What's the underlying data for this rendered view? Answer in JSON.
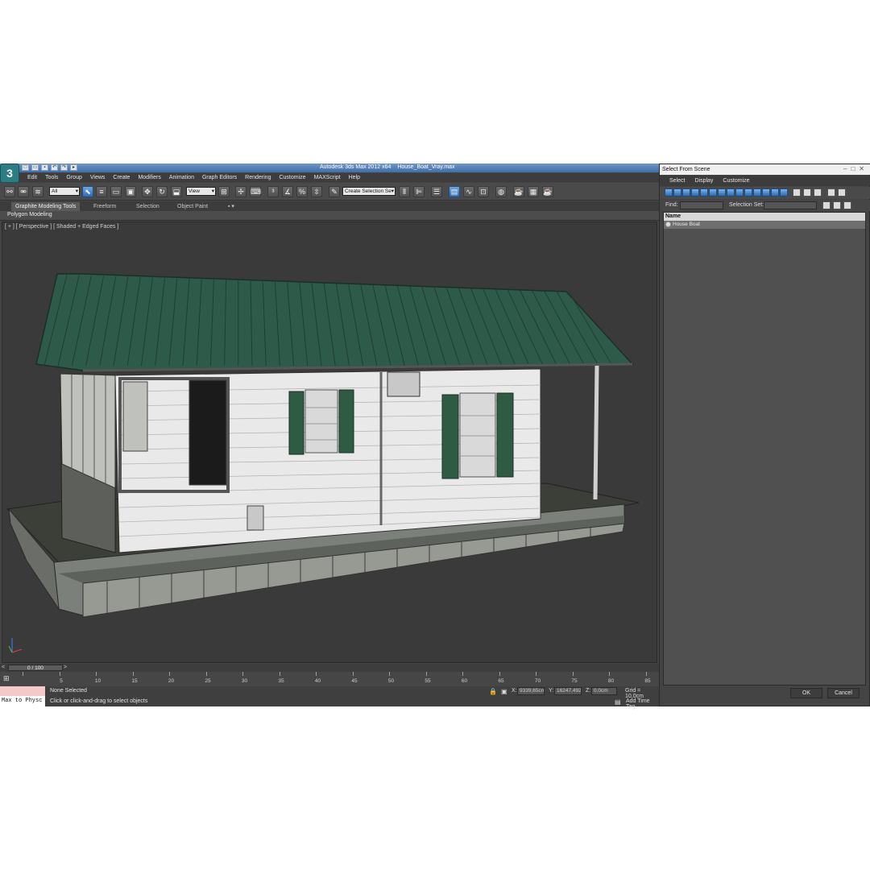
{
  "app": {
    "title": "Autodesk 3ds Max  2012 x64",
    "file": "House_Boat_Vray.max",
    "logo": "3"
  },
  "menu": [
    "Edit",
    "Tools",
    "Group",
    "Views",
    "Create",
    "Modifiers",
    "Animation",
    "Graph Editors",
    "Rendering",
    "Customize",
    "MAXScript",
    "Help"
  ],
  "toolbar": {
    "filter_value": "All",
    "ref_coord": "View",
    "named_selection": "Create Selection Se"
  },
  "ribbon": {
    "tabs": [
      "Graphite Modeling Tools",
      "Freeform",
      "Selection",
      "Object Paint"
    ],
    "active_tab": 0,
    "panel_label": "Polygon Modeling"
  },
  "viewport": {
    "label": "[ + ] [ Perspective ] [ Shaded + Edged Faces ]"
  },
  "timeline": {
    "position": "0 / 100",
    "ticks": [
      "5",
      "10",
      "15",
      "20",
      "25",
      "30",
      "35",
      "40",
      "45",
      "50",
      "55",
      "60",
      "65",
      "70",
      "75",
      "80",
      "85"
    ]
  },
  "status": {
    "script_text": "Max to Physc",
    "selection": "None Selected",
    "hint": "Click or click-and-drag to select objects",
    "x_label": "X:",
    "x_value": "9339,65cm",
    "y_label": "Y:",
    "y_value": "16247,492",
    "z_label": "Z:",
    "z_value": "0,0cm",
    "grid": "Grid = 10,0cm",
    "add_time_tag": "Add Time Tag"
  },
  "dialog": {
    "title": "Select From Scene",
    "menu": [
      "Select",
      "Display",
      "Customize"
    ],
    "find_label": "Find:",
    "selection_set_label": "Selection Set:",
    "column_header": "Name",
    "items": [
      "House Boat"
    ],
    "ok_label": "OK",
    "cancel_label": "Cancel"
  },
  "colors": {
    "roof": "#2e5a4a",
    "siding": "#e9e9e9",
    "shutter": "#2f5a44",
    "hull": "#8c8f88",
    "deck": "#3c3f37",
    "viewport_bg": "#3a3a3a",
    "active_blue": "#2e6cb4"
  }
}
